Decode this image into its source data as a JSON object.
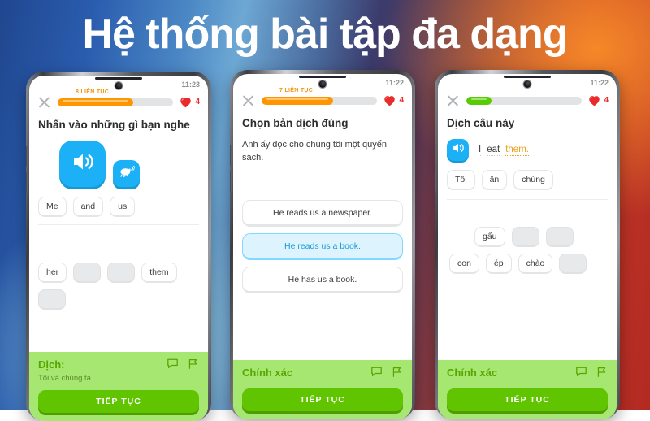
{
  "headline": "Hệ thống bài tập đa dạng",
  "colors": {
    "blue": "#1cb0f6",
    "orange": "#f2950d",
    "green_light": "#a6e771",
    "green_dark": "#58a700",
    "green_button": "#61c400",
    "heart_red": "#ea2b2b",
    "highlight_yellow": "#e8a317"
  },
  "phones": [
    {
      "status_time": "11:23",
      "streak_label": "8 LIÊN TỤC",
      "progress_percent": 65,
      "progress_color": "#ff9600",
      "hearts_count": "4",
      "question_title": "Nhấn vào những gì bạn nghe",
      "audio_main_icon": "speaker-icon",
      "audio_slow_icon": "turtle-icon",
      "answer_tiles": [
        "Me",
        "and",
        "us"
      ],
      "bank_tiles": [
        {
          "label": "her",
          "blank": false
        },
        {
          "label": "",
          "blank": true
        },
        {
          "label": "",
          "blank": true
        },
        {
          "label": "them",
          "blank": false
        },
        {
          "label": "",
          "blank": true
        }
      ],
      "footer_title": "Dịch:",
      "footer_sub": "Tôi và chúng ta",
      "cta_label": "TIẾP TỤC",
      "footer_icon_1": "comment-icon",
      "footer_icon_2": "report-flag-icon"
    },
    {
      "status_time": "11:22",
      "streak_label": "7 LIÊN TỤC",
      "progress_percent": 62,
      "progress_color": "#ff9600",
      "hearts_count": "4",
      "question_title": "Chọn bản dịch đúng",
      "prompt": "Anh ấy đọc cho chúng tôi một quyển sách.",
      "options": [
        {
          "label": "He reads us a newspaper.",
          "selected": false
        },
        {
          "label": "He reads us a book.",
          "selected": true
        },
        {
          "label": "He has us a book.",
          "selected": false
        }
      ],
      "footer_title": "Chính xác",
      "cta_label": "TIẾP TỤC",
      "footer_icon_1": "comment-icon",
      "footer_icon_2": "report-flag-icon"
    },
    {
      "status_time": "11:22",
      "streak_label": "",
      "progress_percent": 22,
      "progress_color": "#58cc02",
      "hearts_count": "4",
      "question_title": "Dịch câu này",
      "sentence_speaker_icon": "speaker-icon",
      "sentence_words": [
        {
          "text": "I",
          "highlight": false
        },
        {
          "text": "eat",
          "highlight": false
        },
        {
          "text": "them.",
          "highlight": true
        }
      ],
      "answer_tiles": [
        "Tôi",
        "ăn",
        "chúng"
      ],
      "bank_row_1": [
        {
          "label": "gấu",
          "blank": false
        },
        {
          "label": "",
          "blank": true
        },
        {
          "label": "",
          "blank": true
        }
      ],
      "bank_row_2": [
        {
          "label": "con",
          "blank": false
        },
        {
          "label": "ép",
          "blank": false
        },
        {
          "label": "chào",
          "blank": false
        },
        {
          "label": "",
          "blank": true
        }
      ],
      "footer_title": "Chính xác",
      "cta_label": "TIẾP TỤC",
      "footer_icon_1": "comment-icon",
      "footer_icon_2": "report-flag-icon"
    }
  ]
}
